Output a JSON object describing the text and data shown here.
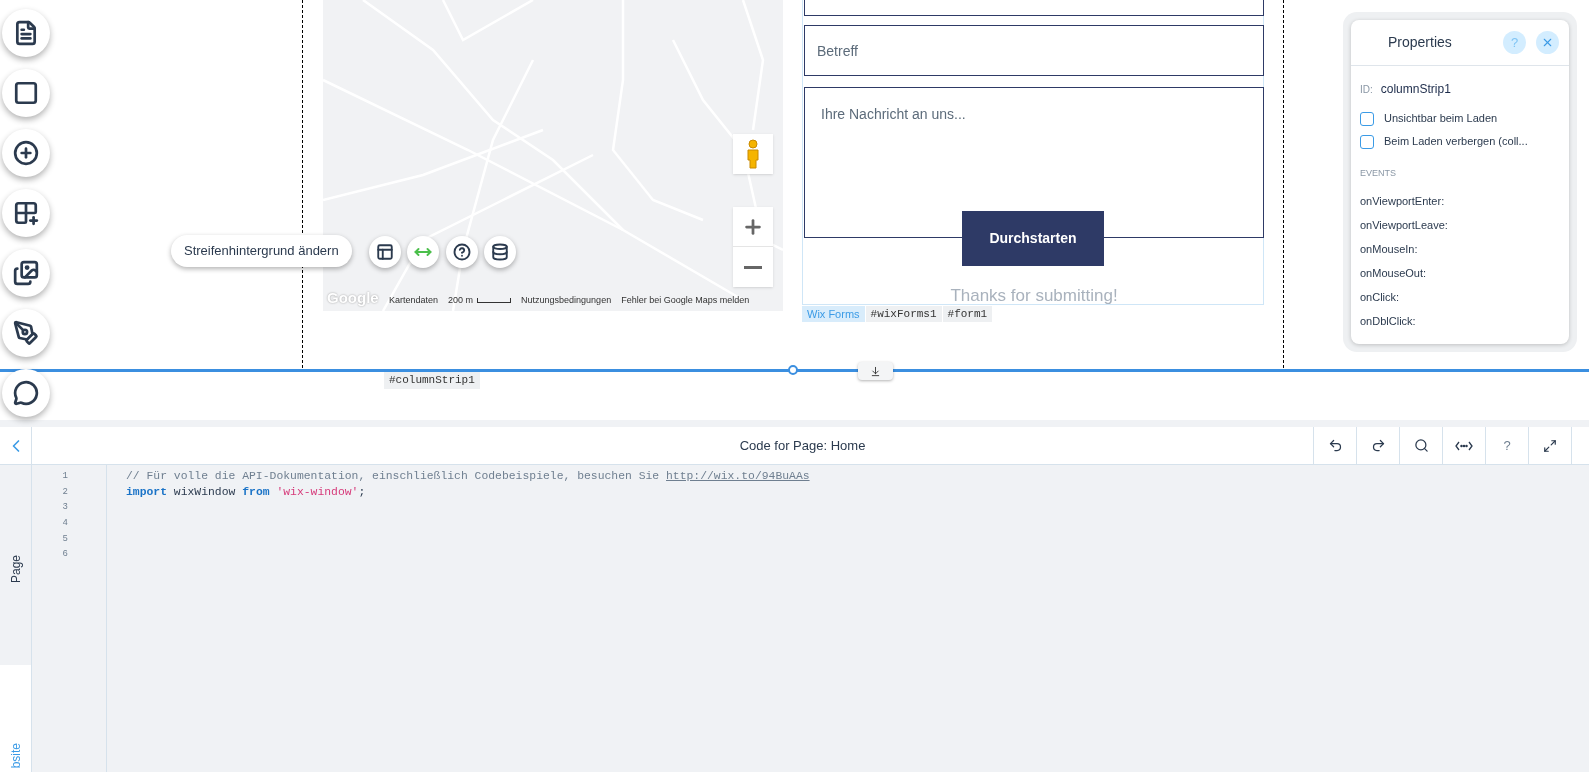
{
  "strip_toolbar": {
    "label": "Streifenhintergrund ändern"
  },
  "map": {
    "logo": "Google",
    "attribution": [
      "Kartendaten",
      "200 m",
      "Nutzungsbedingungen",
      "Fehler bei Google Maps melden"
    ]
  },
  "form": {
    "fields": [
      {
        "kind": "line"
      },
      {
        "kind": "line",
        "placeholder": "Betreff"
      },
      {
        "kind": "area",
        "placeholder": "Ihre Nachricht an uns..."
      }
    ],
    "submit": "Durchstarten",
    "success": "Thanks for submitting!",
    "tags": [
      {
        "label": "Wix Forms",
        "kind": "type"
      },
      {
        "label": "#wixForms1",
        "kind": "id"
      },
      {
        "label": "#form1",
        "kind": "id"
      }
    ]
  },
  "strip_tag": "#columnStrip1",
  "properties": {
    "title": "Properties",
    "help": "?",
    "id_label": "ID:",
    "id": "columnStrip1",
    "options": [
      {
        "label": "Unsichtbar beim Laden",
        "checked": false
      },
      {
        "label": "Beim Laden verbergen (coll...",
        "checked": false
      }
    ],
    "events_heading": "EVENTS",
    "events": [
      "onViewportEnter:",
      "onViewportLeave:",
      "onMouseIn:",
      "onMouseOut:",
      "onClick:",
      "onDblClick:"
    ]
  },
  "code_panel": {
    "title": "Code for Page: Home",
    "help": "?",
    "side_tabs": [
      {
        "label": "Page",
        "selected": false
      },
      {
        "label": "bsite",
        "selected": true
      }
    ],
    "lines": [
      {
        "number": "1",
        "tokens": [
          {
            "kind": "comment",
            "text": "// Für volle die API-Dokumentation, einschließlich Codebeispiele, besuchen Sie "
          },
          {
            "kind": "link",
            "text": "http://wix.to/94BuAAs"
          }
        ]
      },
      {
        "number": "2",
        "tokens": [
          {
            "kind": "keyword",
            "text": "import"
          },
          {
            "kind": "plain",
            "text": " wixWindow "
          },
          {
            "kind": "keyword",
            "text": "from "
          },
          {
            "kind": "string",
            "text": "'wix-window'"
          },
          {
            "kind": "plain",
            "text": ";"
          }
        ]
      },
      {
        "number": "3"
      },
      {
        "number": "4"
      },
      {
        "number": "5"
      },
      {
        "number": "6"
      }
    ]
  }
}
